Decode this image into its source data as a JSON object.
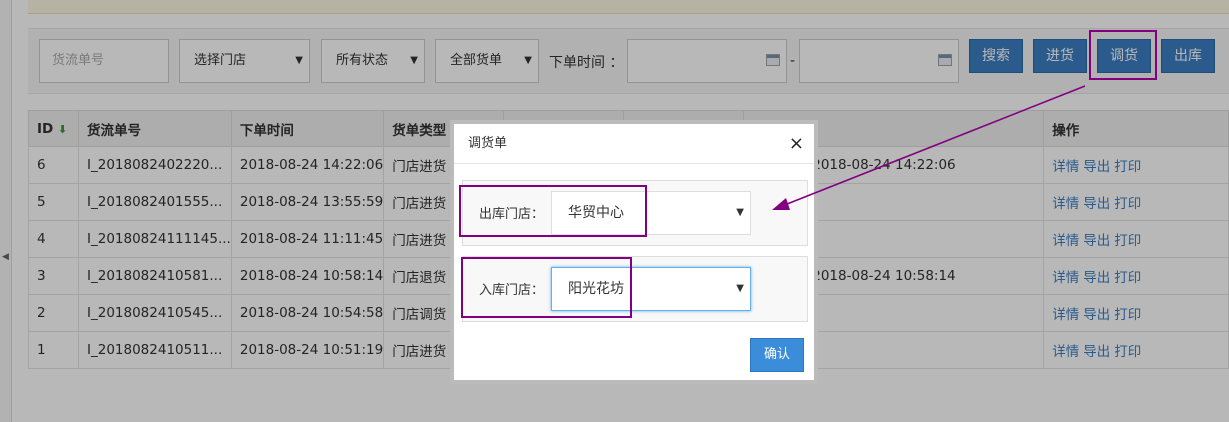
{
  "filters": {
    "order_no_placeholder": "货流单号",
    "store_select": "选择门店",
    "status_select": "所有状态",
    "type_select": "全部货单",
    "time_label": "下单时间 ：",
    "date_from": "",
    "date_to": "",
    "date_sep": "-",
    "caret": "▼"
  },
  "buttons": {
    "search": "搜索",
    "stock_in": "进货",
    "transfer": "调货",
    "stock_out": "出库"
  },
  "table": {
    "headers": [
      "ID",
      "货流单号",
      "下单时间",
      "货单类型",
      "",
      "",
      "",
      "操作"
    ],
    "rows": [
      {
        "id": "6",
        "no": "I_2018082402220...",
        "time": "2018-08-24 14:22:06",
        "type": "门店进货",
        "extra": "2018-08-24 14:22:06"
      },
      {
        "id": "5",
        "no": "I_2018082401555...",
        "time": "2018-08-24 13:55:59",
        "type": "门店进货",
        "extra": ""
      },
      {
        "id": "4",
        "no": "I_20180824111145...",
        "time": "2018-08-24 11:11:45",
        "type": "门店进货",
        "extra": ""
      },
      {
        "id": "3",
        "no": "I_2018082410581...",
        "time": "2018-08-24 10:58:14",
        "type": "门店退货",
        "extra": "2018-08-24 10:58:14"
      },
      {
        "id": "2",
        "no": "I_2018082410545...",
        "time": "2018-08-24 10:54:58",
        "type": "门店调货",
        "extra": ""
      },
      {
        "id": "1",
        "no": "I_2018082410511...",
        "time": "2018-08-24 10:51:19",
        "type": "门店进货",
        "extra": ""
      }
    ],
    "ops": {
      "detail": "详情",
      "export": "导出",
      "print": "打印"
    }
  },
  "modal": {
    "title": "调货单",
    "close": "×",
    "out_label": "出库门店：",
    "out_value": "华贸中心",
    "in_label": "入库门店：",
    "in_value": "阳光花坊",
    "confirm": "确认"
  },
  "colors": {
    "primary": "#3c7fc2",
    "highlight": "#800080",
    "link": "#3c7fc2"
  }
}
